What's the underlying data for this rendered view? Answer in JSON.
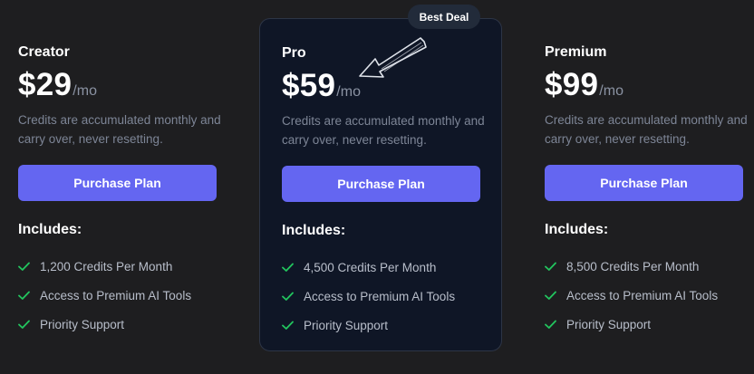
{
  "colors": {
    "page_background": "#1e1e20",
    "card_background": "#0f1626",
    "card_border": "#2d3546",
    "accent_button": "#6466f1",
    "check_icon": "#22c55e",
    "muted_text": "#7d8596"
  },
  "badge": {
    "label": "Best Deal"
  },
  "plans": [
    {
      "name": "Creator",
      "price": "$29",
      "period": "/mo",
      "description": "Credits are accumulated monthly and carry over, never resetting.",
      "button_label": "Purchase Plan",
      "includes_label": "Includes:",
      "features": [
        "1,200 Credits Per Month",
        "Access to Premium AI Tools",
        "Priority Support"
      ],
      "icon": "check-icon"
    },
    {
      "name": "Pro",
      "price": "$59",
      "period": "/mo",
      "description": "Credits are accumulated monthly and carry over, never resetting.",
      "button_label": "Purchase Plan",
      "includes_label": "Includes:",
      "features": [
        "4,500 Credits Per Month",
        "Access to Premium AI Tools",
        "Priority Support"
      ],
      "icon": "check-icon"
    },
    {
      "name": "Premium",
      "price": "$99",
      "period": "/mo",
      "description": "Credits are accumulated monthly and carry over, never resetting.",
      "button_label": "Purchase Plan",
      "includes_label": "Includes:",
      "features": [
        "8,500 Credits Per Month",
        "Access to Premium AI Tools",
        "Priority Support"
      ],
      "icon": "check-icon"
    }
  ]
}
